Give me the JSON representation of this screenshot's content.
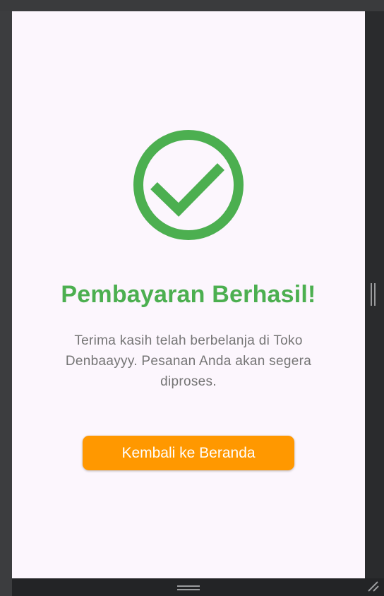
{
  "screen": {
    "title": "Pembayaran Berhasil!",
    "message": "Terima kasih telah berbelanja di Toko Denbaayyy. Pesanan Anda akan segera diproses.",
    "button_label": "Kembali ke Beranda"
  },
  "icons": {
    "status_icon": "check-circle-icon"
  },
  "colors": {
    "success": "#4caf50",
    "accent": "#ff9800",
    "background": "#fcf6fd",
    "message_text": "#757575",
    "frame": "#2b2c2e"
  }
}
